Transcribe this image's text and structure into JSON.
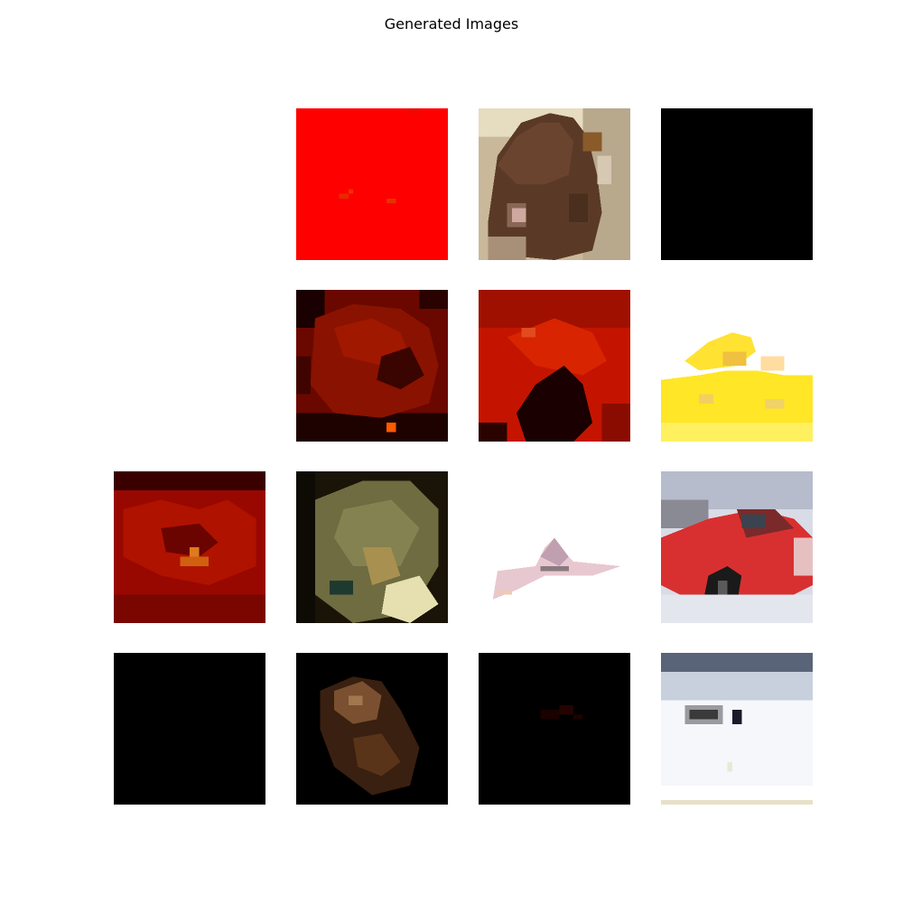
{
  "figure": {
    "title": "Generated Images"
  },
  "grid": {
    "rows": 4,
    "columns": 4
  },
  "tiles": [
    {
      "row": 0,
      "col": 0,
      "blank": true
    },
    {
      "row": 0,
      "col": 1,
      "subject": "solid red noise",
      "dominant_color": "#ff0000"
    },
    {
      "row": 0,
      "col": 2,
      "subject": "brown furry animal",
      "dominant_color": "#5a3a26"
    },
    {
      "row": 0,
      "col": 3,
      "subject": "solid black",
      "dominant_color": "#000000"
    },
    {
      "row": 1,
      "col": 0,
      "blank": true
    },
    {
      "row": 1,
      "col": 1,
      "subject": "dark red texture",
      "dominant_color": "#7a0a00"
    },
    {
      "row": 1,
      "col": 2,
      "subject": "red texture",
      "dominant_color": "#c01000"
    },
    {
      "row": 1,
      "col": 3,
      "subject": "yellow object",
      "dominant_color": "#ffe030"
    },
    {
      "row": 2,
      "col": 0,
      "subject": "red texture",
      "dominant_color": "#9a0800"
    },
    {
      "row": 2,
      "col": 1,
      "subject": "olive animal",
      "dominant_color": "#6a6a3a"
    },
    {
      "row": 2,
      "col": 2,
      "subject": "airplane on white",
      "dominant_color": "#ffffff"
    },
    {
      "row": 2,
      "col": 3,
      "subject": "red car",
      "dominant_color": "#d83030"
    },
    {
      "row": 3,
      "col": 0,
      "subject": "solid black",
      "dominant_color": "#000000"
    },
    {
      "row": 3,
      "col": 1,
      "subject": "dark brown blob",
      "dominant_color": "#3a2010"
    },
    {
      "row": 3,
      "col": 2,
      "subject": "near-black",
      "dominant_color": "#0a0000"
    },
    {
      "row": 3,
      "col": 3,
      "subject": "snowy scene",
      "dominant_color": "#f0f2f6"
    }
  ]
}
